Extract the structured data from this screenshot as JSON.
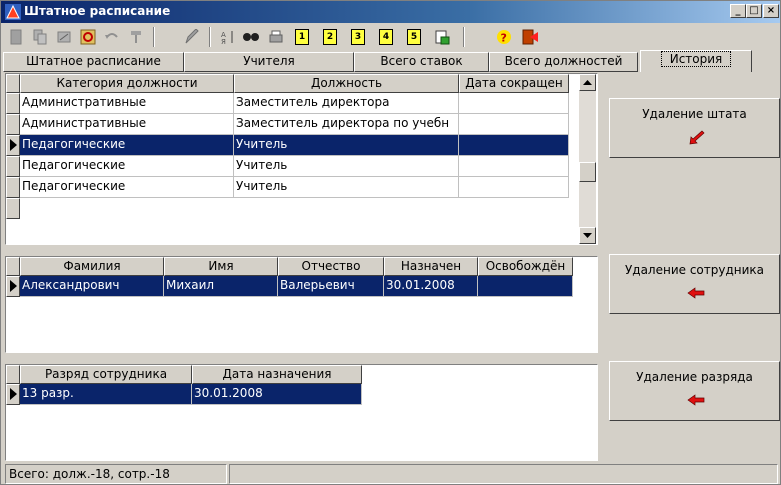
{
  "window": {
    "title": "Штатное расписание"
  },
  "tabs": [
    {
      "label": "Штатное расписание"
    },
    {
      "label": "Учителя"
    },
    {
      "label": "Всего ставок"
    },
    {
      "label": "Всего должностей"
    },
    {
      "label": "История"
    }
  ],
  "toolbar": {
    "icons": [
      "new-icon",
      "copy-icon",
      "edit-icon",
      "refresh-icon",
      "undo-icon",
      "export-icon",
      "edit-tool-icon",
      "sort-icon",
      "find-icon",
      "print-icon",
      "page-1-icon",
      "page-2-icon",
      "page-3-icon",
      "page-4-icon",
      "page-5-icon",
      "report-icon",
      "help-icon",
      "exit-icon"
    ],
    "numbers": [
      "1",
      "2",
      "3",
      "4",
      "5"
    ]
  },
  "positions_grid": {
    "columns": [
      "Категория должности",
      "Должность",
      "Дата сокращен"
    ],
    "rows": [
      [
        "Административные",
        "Заместитель директора",
        ""
      ],
      [
        "Административные",
        "Заместитель директора по учебн",
        ""
      ],
      [
        "Педагогические",
        "Учитель",
        ""
      ],
      [
        "Педагогические",
        "Учитель",
        ""
      ],
      [
        "Педагогические",
        "Учитель",
        ""
      ]
    ],
    "selected_row": 2
  },
  "employees_grid": {
    "columns": [
      "Фамилия",
      "Имя",
      "Отчество",
      "Назначен",
      "Освобождён"
    ],
    "rows": [
      [
        "Александрович",
        "Михаил",
        "Валерьевич",
        "30.01.2008",
        ""
      ]
    ],
    "selected_row": 0
  },
  "grades_grid": {
    "columns": [
      "Разряд сотрудника",
      "Дата назначения"
    ],
    "rows": [
      [
        "13 разр.",
        "30.01.2008"
      ]
    ],
    "selected_row": 0
  },
  "buttons": {
    "delete_staff": "Удаление штата",
    "delete_employee": "Удаление сотрудника",
    "delete_grade": "Удаление разряда"
  },
  "statusbar": {
    "text": "Всего: долж.-18, сотр.-18"
  },
  "colors": {
    "selection": "#0a246a",
    "title_gradient_start": "#0a246a",
    "arrow_red": "#e01010"
  }
}
